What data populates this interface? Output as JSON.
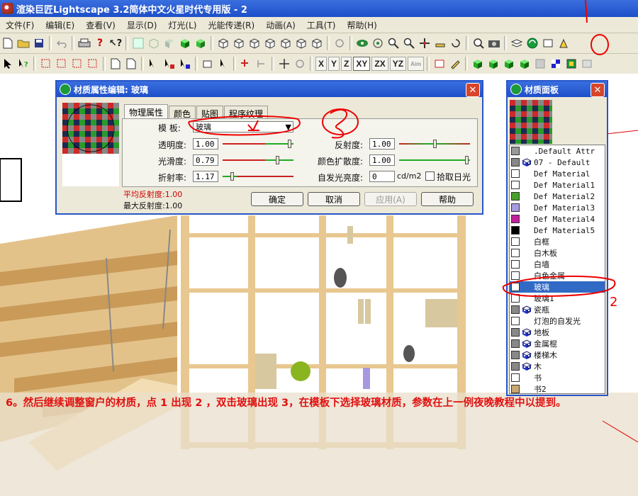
{
  "window": {
    "title": "渲染巨匠Lightscape 3.2简体中文火星时代专用版 - 2"
  },
  "menu": [
    "文件(F)",
    "编辑(E)",
    "查看(V)",
    "显示(D)",
    "灯光(L)",
    "光能传递(R)",
    "动画(A)",
    "工具(T)",
    "帮助(H)"
  ],
  "axis_buttons": [
    "X",
    "Y",
    "Z",
    "XY",
    "ZX",
    "YZ",
    "Aim"
  ],
  "material_dialog": {
    "title": "材质属性编辑: 玻璃",
    "tabs": [
      "物理属性",
      "颜色",
      "贴图",
      "程序纹理"
    ],
    "template_label": "模 板:",
    "template_value": "玻璃",
    "params": [
      {
        "label": "透明度:",
        "value": "1.00",
        "level": 0.97
      },
      {
        "label": "光滑度:",
        "value": "0.79",
        "level": 0.79
      },
      {
        "label": "折射率:",
        "value": "1.17",
        "level": 0.12
      },
      {
        "label": "反射度:",
        "value": "1.00",
        "level": 0.5
      },
      {
        "label": "颜色扩散度:",
        "value": "1.00",
        "level": 0.98
      },
      {
        "label": "自发光亮度:",
        "value": "0",
        "unit": "cd/m2"
      }
    ],
    "checkbox_label": "拾取日光",
    "avg_reflect": "平均反射度:1.00",
    "max_reflect": "最大反射度:1.00",
    "buttons": {
      "ok": "确定",
      "cancel": "取消",
      "apply": "应用(A)",
      "help": "帮助"
    }
  },
  "material_panel": {
    "title": "材质面板",
    "items": [
      {
        "name": ".Default Attr",
        "color": "#999999",
        "cube": false
      },
      {
        "name": "07 - Default",
        "color": "#888888",
        "cube": true
      },
      {
        "name": "Def Material",
        "color": "#ffffff",
        "cube": false
      },
      {
        "name": "Def Material1",
        "color": "#ffffff",
        "cube": false
      },
      {
        "name": "Def Material2",
        "color": "#4aa02a",
        "cube": false
      },
      {
        "name": "Def Material3",
        "color": "#a89ae0",
        "cube": false
      },
      {
        "name": "Def Material4",
        "color": "#c0209a",
        "cube": false
      },
      {
        "name": "Def Material5",
        "color": "#000000",
        "cube": false
      },
      {
        "name": "白框",
        "color": "#ffffff",
        "cube": false
      },
      {
        "name": "白木板",
        "color": "#ffffff",
        "cube": false
      },
      {
        "name": "白墙",
        "color": "#ffffff",
        "cube": false
      },
      {
        "name": "白色金属",
        "color": "#ffffff",
        "cube": false
      },
      {
        "name": "玻璃",
        "color": "#ffffff",
        "cube": false,
        "selected": true
      },
      {
        "name": "玻璃1",
        "color": "#ffffff",
        "cube": false
      },
      {
        "name": "瓷瓶",
        "color": "#888888",
        "cube": true
      },
      {
        "name": "灯泡的自发光",
        "color": "#ffffff",
        "cube": false
      },
      {
        "name": "地板",
        "color": "#888888",
        "cube": true
      },
      {
        "name": "金属棍",
        "color": "#888888",
        "cube": true
      },
      {
        "name": "楼梯木",
        "color": "#888888",
        "cube": true
      },
      {
        "name": "木",
        "color": "#888888",
        "cube": true
      },
      {
        "name": "书",
        "color": "#ffffff",
        "cube": false
      },
      {
        "name": "书2",
        "color": "#c8a870",
        "cube": false
      }
    ]
  },
  "annotations": {
    "two": "2"
  },
  "caption": "6。然后继续调整窗户的材质，点 1 出现 2 ，双击玻璃出现 3，在模板下选择玻璃材质，参数在上一例夜晚教程中以提到。"
}
